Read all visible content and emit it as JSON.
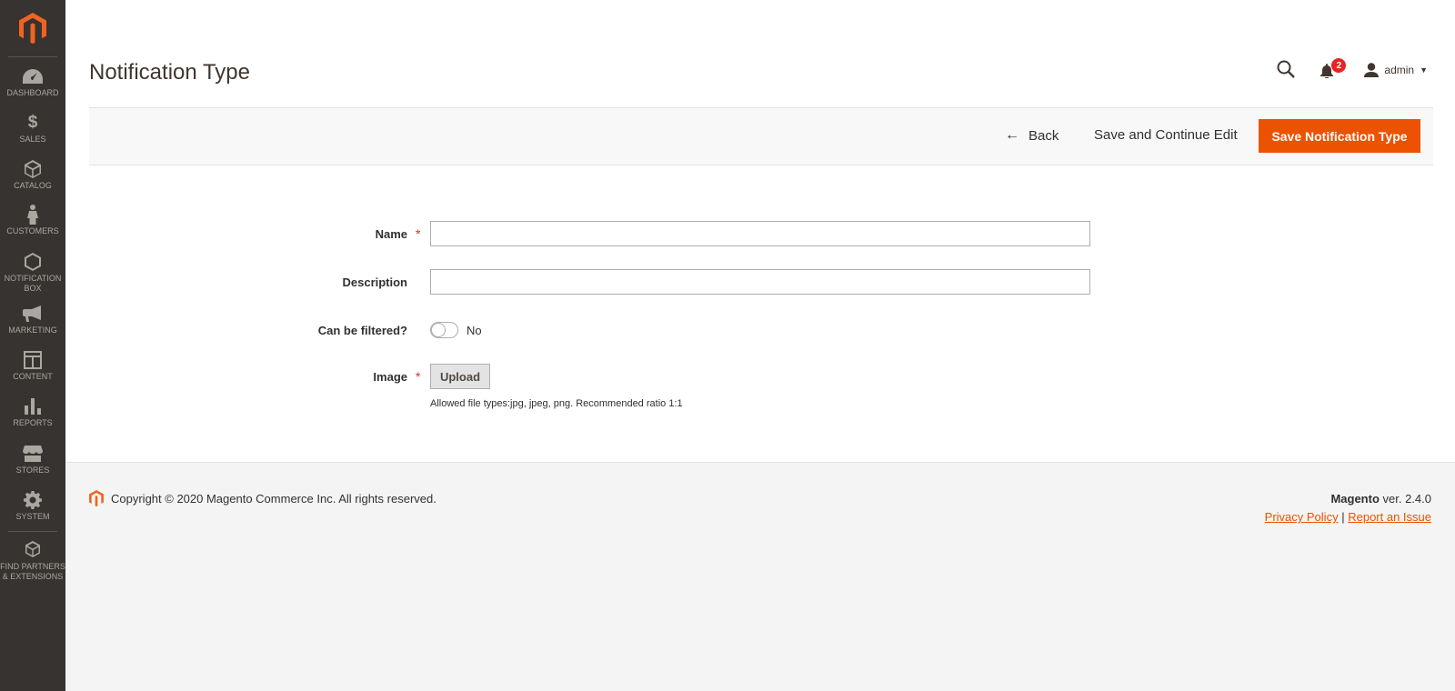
{
  "sidebar": {
    "items": [
      {
        "label": "DASHBOARD",
        "icon": "dashboard-icon"
      },
      {
        "label": "SALES",
        "icon": "dollar-icon"
      },
      {
        "label": "CATALOG",
        "icon": "box-icon"
      },
      {
        "label": "CUSTOMERS",
        "icon": "person-icon"
      },
      {
        "label": "NOTIFICATION BOX",
        "icon": "hexagon-icon"
      },
      {
        "label": "MARKETING",
        "icon": "megaphone-icon"
      },
      {
        "label": "CONTENT",
        "icon": "layout-icon"
      },
      {
        "label": "REPORTS",
        "icon": "bar-chart-icon"
      },
      {
        "label": "STORES",
        "icon": "storefront-icon"
      },
      {
        "label": "SYSTEM",
        "icon": "gear-icon"
      },
      {
        "label": "FIND PARTNERS & EXTENSIONS",
        "icon": "cubes-icon"
      }
    ]
  },
  "header": {
    "title": "Notification Type",
    "notification_count": "2",
    "user_name": "admin"
  },
  "actions": {
    "back": "Back",
    "save_continue": "Save and Continue Edit",
    "save": "Save Notification Type"
  },
  "form": {
    "name_label": "Name",
    "name_value": "",
    "description_label": "Description",
    "description_value": "",
    "filtered_label": "Can be filtered?",
    "filtered_value": "No",
    "image_label": "Image",
    "upload_label": "Upload",
    "image_note": "Allowed file types:jpg, jpeg, png. Recommended ratio 1:1",
    "required_mark": "*"
  },
  "footer": {
    "copyright": "Copyright © 2020 Magento Commerce Inc. All rights reserved.",
    "brand": "Magento",
    "version": "ver. 2.4.0",
    "privacy": "Privacy Policy",
    "separator": "|",
    "report": "Report an Issue"
  },
  "colors": {
    "accent": "#eb5202",
    "sidebar_bg": "#373330",
    "badge": "#e22626"
  }
}
